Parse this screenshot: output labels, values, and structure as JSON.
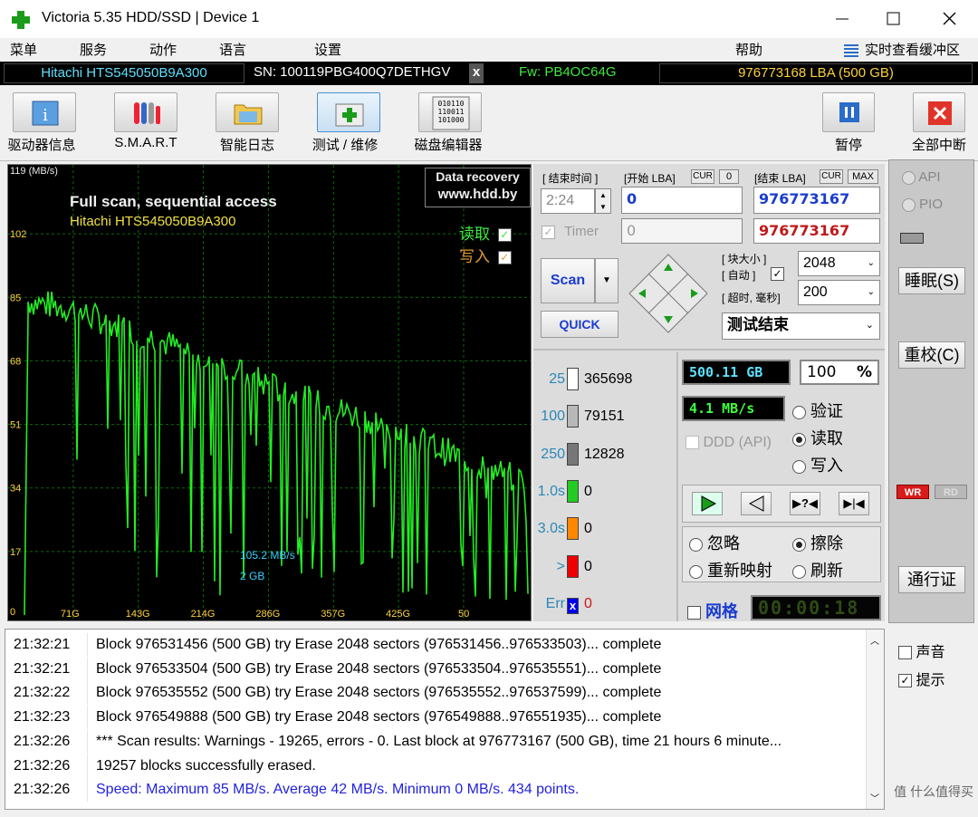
{
  "window": {
    "title": "Victoria 5.35 HDD/SSD | Device 1"
  },
  "menu": {
    "items": [
      "菜单",
      "服务",
      "动作",
      "语言",
      "设置"
    ],
    "help": "帮助",
    "buffer": "实时查看缓冲区"
  },
  "device": {
    "model": "Hitachi HTS545050B9A300",
    "serial": "SN: 100119PBG400Q7DETHGV",
    "close": "x",
    "firmware": "Fw: PB4OC64G",
    "lba": "976773168 LBA (500 GB)"
  },
  "toolbar": {
    "left": [
      {
        "label": "驱动器信息",
        "icon": "info-icon"
      },
      {
        "label": "S.M.A.R.T",
        "icon": "smart-icon"
      },
      {
        "label": "智能日志",
        "icon": "folder-icon"
      },
      {
        "label": "测试 / 维修",
        "icon": "test-repair-icon"
      },
      {
        "label": "磁盘编辑器",
        "icon": "disk-editor-icon"
      }
    ],
    "pause": "暂停",
    "abort": "全部中断"
  },
  "graph": {
    "y_unit": "119 (MB/s)",
    "y_ticks": [
      "102",
      "85",
      "68",
      "51",
      "34",
      "17",
      "0"
    ],
    "x_ticks": [
      "71G",
      "143G",
      "214G",
      "286G",
      "357G",
      "425G",
      "50"
    ],
    "title": "Full scan, sequential access",
    "subtitle": "Hitachi HTS545050B9A300",
    "badge_line1": "Data recovery",
    "badge_line2": "www.hdd.by",
    "read_label": "读取",
    "write_label": "写入",
    "cursor_speed": "105.2 MB/s",
    "cursor_pos": "2 GB",
    "colors": {
      "trace": "#22ee22",
      "grid": "#0b6b0b"
    }
  },
  "chart_data": {
    "type": "line",
    "title": "Full scan, sequential access",
    "ylabel": "119 (MB/s)",
    "xlabel": "",
    "ylim": [
      0,
      119
    ],
    "x_ticks": [
      "71G",
      "143G",
      "214G",
      "286G",
      "357G",
      "425G",
      "50"
    ],
    "y_ticks": [
      102,
      85,
      68,
      51,
      34,
      17,
      0
    ],
    "series": [
      {
        "name": "读取",
        "x_gb": [
          0,
          20,
          40,
          60,
          80,
          100,
          120,
          143,
          170,
          200,
          214,
          250,
          286,
          320,
          357,
          390,
          425,
          460,
          500
        ],
        "values": [
          80,
          84,
          83,
          82,
          80,
          78,
          76,
          74,
          71,
          68,
          66,
          62,
          58,
          55,
          52,
          48,
          44,
          40,
          36
        ]
      }
    ]
  },
  "controls": {
    "end_time_label": "[ 结束时间 ]",
    "start_lba_label": "[开始 LBA]",
    "cur1": "CUR",
    "zero": "0",
    "end_lba_label": "[结束 LBA]",
    "cur2": "CUR",
    "max": "MAX",
    "time": "2:24",
    "start_lba": "0",
    "end_lba": "976773167",
    "timer_label": "Timer",
    "timer_value": "0",
    "end_lba2": "976773167",
    "block_size_label": "[ 块大小 ]",
    "auto_label": "[ 自动 ]",
    "timeout_label": "[ 超时, 毫秒]",
    "block_size": "2048",
    "timeout": "200",
    "scan": "Scan",
    "quick": "QUICK",
    "status": "测试结束"
  },
  "stats": [
    {
      "label": "25",
      "value": "365698",
      "color": "#ffffff"
    },
    {
      "label": "100",
      "value": "79151",
      "color": "#b8b8b8"
    },
    {
      "label": "250",
      "value": "12828",
      "color": "#777777"
    },
    {
      "label": "1.0s",
      "value": "0",
      "color": "#22cc22"
    },
    {
      "label": "3.0s",
      "value": "0",
      "color": "#ff8800"
    },
    {
      "label": ">",
      "value": "0",
      "color": "#ee0000"
    },
    {
      "label": "Err",
      "value": "0",
      "color": "#0000ee"
    }
  ],
  "status": {
    "size": "500.11 GB",
    "percent": "100",
    "percent_sign": "%",
    "speed": "4.1 MB/s",
    "verify": "验证",
    "read": "读取",
    "write": "写入",
    "ddd": "DDD (API)",
    "ignore": "忽略",
    "erase": "擦除",
    "remap": "重新映射",
    "refresh": "刷新",
    "grid": "网格",
    "elapsed": "00:00:18"
  },
  "side": {
    "api": "API",
    "pio": "PIO",
    "sleep": "睡眠(S)",
    "recal": "重校(C)",
    "wr": "WR",
    "rd": "RD",
    "passport": "通行证"
  },
  "log": [
    {
      "time": "21:32:21",
      "msg": "Block 976531456 (500 GB) try Erase 2048 sectors (976531456..976533503)... complete",
      "color": "#000"
    },
    {
      "time": "21:32:21",
      "msg": "Block 976533504 (500 GB) try Erase 2048 sectors (976533504..976535551)... complete",
      "color": "#000"
    },
    {
      "time": "21:32:22",
      "msg": "Block 976535552 (500 GB) try Erase 2048 sectors (976535552..976537599)... complete",
      "color": "#000"
    },
    {
      "time": "21:32:23",
      "msg": "Block 976549888 (500 GB) try Erase 2048 sectors (976549888..976551935)... complete",
      "color": "#000"
    },
    {
      "time": "21:32:26",
      "msg": "*** Scan results: Warnings - 19265, errors - 0. Last block at 976773167 (500 GB), time 21 hours 6 minute...",
      "color": "#000"
    },
    {
      "time": "21:32:26",
      "msg": "19257 blocks successfully erased.",
      "color": "#000"
    },
    {
      "time": "21:32:26",
      "msg": "Speed: Maximum 85 MB/s. Average 42 MB/s. Minimum 0 MB/s. 434 points.",
      "color": "#2222dd"
    }
  ],
  "rside": {
    "sound": "声音",
    "hint": "提示"
  },
  "watermark": "值 什么值得买"
}
